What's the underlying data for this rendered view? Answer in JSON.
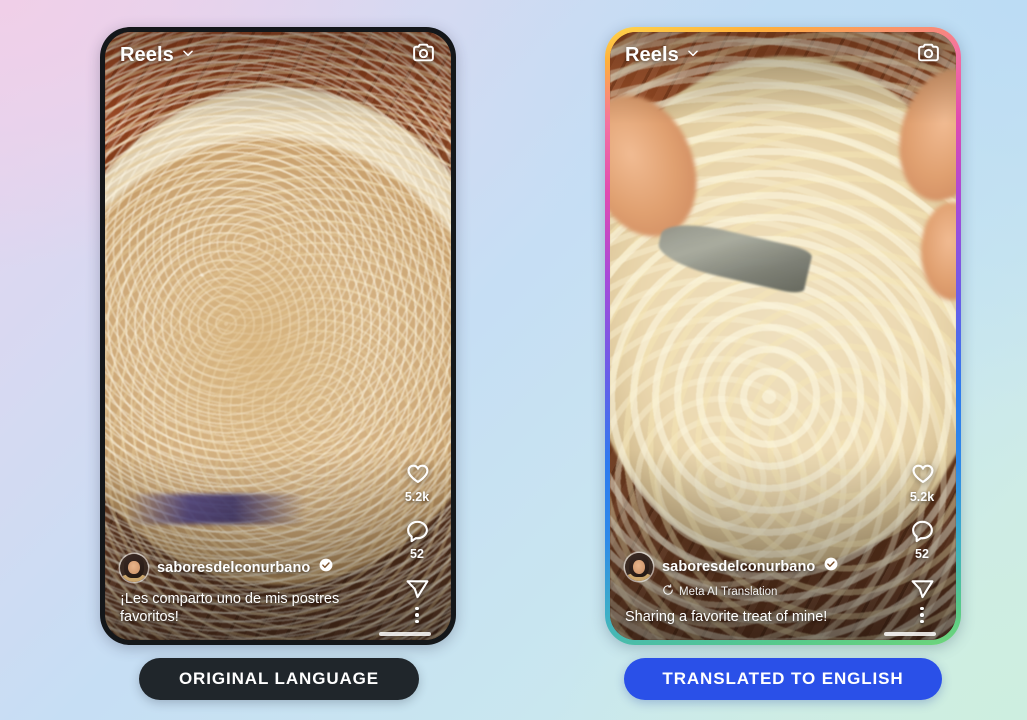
{
  "background": {
    "gradient_stops": [
      "#e7d4ef",
      "#c6def4",
      "#c9e7ef",
      "#d2eee2"
    ]
  },
  "panels": [
    {
      "id": "original",
      "frame_style": "black",
      "topbar": {
        "title": "Reels",
        "chevron_icon": "chevron-down-icon",
        "camera_icon": "camera-icon"
      },
      "actions": {
        "like": {
          "icon": "heart-icon",
          "count": "5.2k"
        },
        "comment": {
          "icon": "comment-icon",
          "count": "52"
        },
        "share": {
          "icon": "send-icon",
          "count": ""
        }
      },
      "meta": {
        "avatar_icon": "avatar",
        "username": "saboresdelconurbano",
        "verified_icon": "verified-badge-icon",
        "translation_label": null,
        "translation_icon": null,
        "caption": "¡Les comparto uno de mis postres favoritos!"
      },
      "more_icon": "kebab-menu-icon",
      "button": {
        "label": "ORIGINAL LANGUAGE",
        "bg_color": "#20262b",
        "text_color": "#ffffff"
      }
    },
    {
      "id": "translated",
      "frame_style": "instagram-gradient",
      "topbar": {
        "title": "Reels",
        "chevron_icon": "chevron-down-icon",
        "camera_icon": "camera-icon"
      },
      "actions": {
        "like": {
          "icon": "heart-icon",
          "count": "5.2k"
        },
        "comment": {
          "icon": "comment-icon",
          "count": "52"
        },
        "share": {
          "icon": "send-icon",
          "count": ""
        }
      },
      "meta": {
        "avatar_icon": "avatar",
        "username": "saboresdelconurbano",
        "verified_icon": "verified-badge-icon",
        "translation_label": "Meta AI Translation",
        "translation_icon": "translation-spinner-icon",
        "caption": "Sharing a favorite treat of mine!"
      },
      "more_icon": "kebab-menu-icon",
      "button": {
        "label": "TRANSLATED TO ENGLISH",
        "bg_color": "#2a50e8",
        "text_color": "#ffffff"
      }
    }
  ]
}
